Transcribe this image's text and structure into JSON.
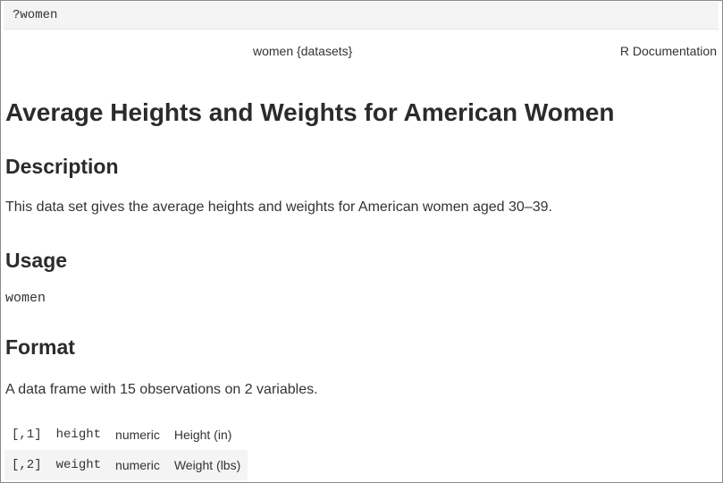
{
  "console": {
    "command": "?women"
  },
  "doc_header": {
    "package": "women {datasets}",
    "source": "R Documentation"
  },
  "title": "Average Heights and Weights for American Women",
  "description": {
    "heading": "Description",
    "text": "This data set gives the average heights and weights for American women aged 30–39."
  },
  "usage": {
    "heading": "Usage",
    "code": "women"
  },
  "format": {
    "heading": "Format",
    "text": "A data frame with 15 observations on 2 variables.",
    "rows": [
      {
        "index": "[,1]",
        "name": "height",
        "type": "numeric",
        "desc": "Height (in)"
      },
      {
        "index": "[,2]",
        "name": "weight",
        "type": "numeric",
        "desc": "Weight (lbs)"
      }
    ]
  }
}
